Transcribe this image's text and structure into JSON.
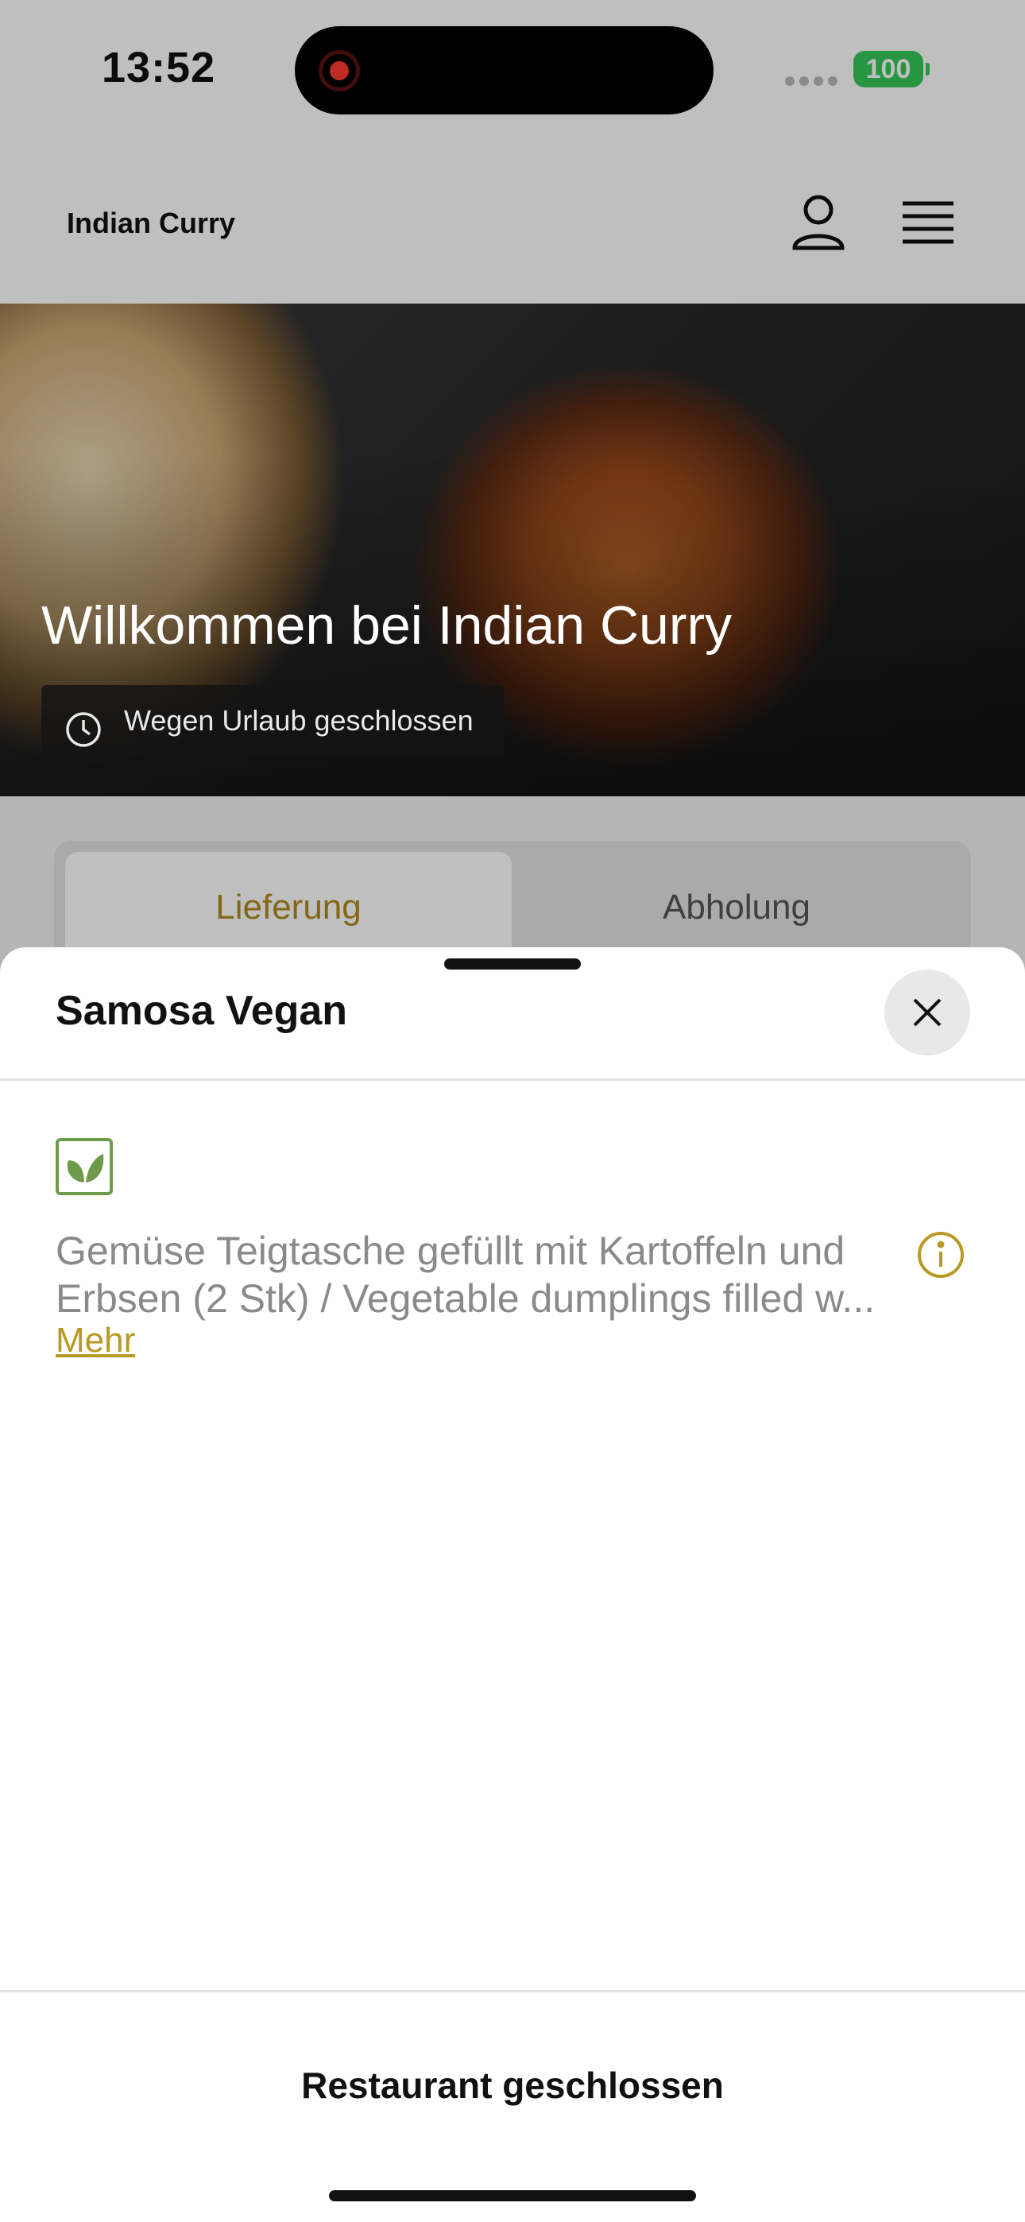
{
  "status_bar": {
    "time": "13:52",
    "battery": "100",
    "signal_icon": "signal-dots-icon"
  },
  "header": {
    "brand": "Indian Curry",
    "user_icon": "user-icon",
    "menu_icon": "hamburger-menu-icon"
  },
  "hero": {
    "title": "Willkommen bei Indian Curry",
    "badge": "Wegen Urlaub geschlossen",
    "badge_icon": "clock-icon"
  },
  "tabs": [
    {
      "label": "Lieferung",
      "selected": true
    },
    {
      "label": "Abholung",
      "selected": false
    }
  ],
  "sheet": {
    "title": "Samosa Vegan",
    "close_icon": "close-icon",
    "diet_icon": "leaf-icon",
    "description": "Gemüse Teigtasche gefüllt mit Kartoffeln und Erbsen (2 Stk) / Vegetable dumplings filled w...",
    "more_label": "Mehr",
    "info_icon": "info-icon",
    "footer_label": "Restaurant geschlossen"
  },
  "colors": {
    "accent": "#b89a22",
    "veg_green": "#6e9a4a",
    "battery": "#34c759"
  }
}
